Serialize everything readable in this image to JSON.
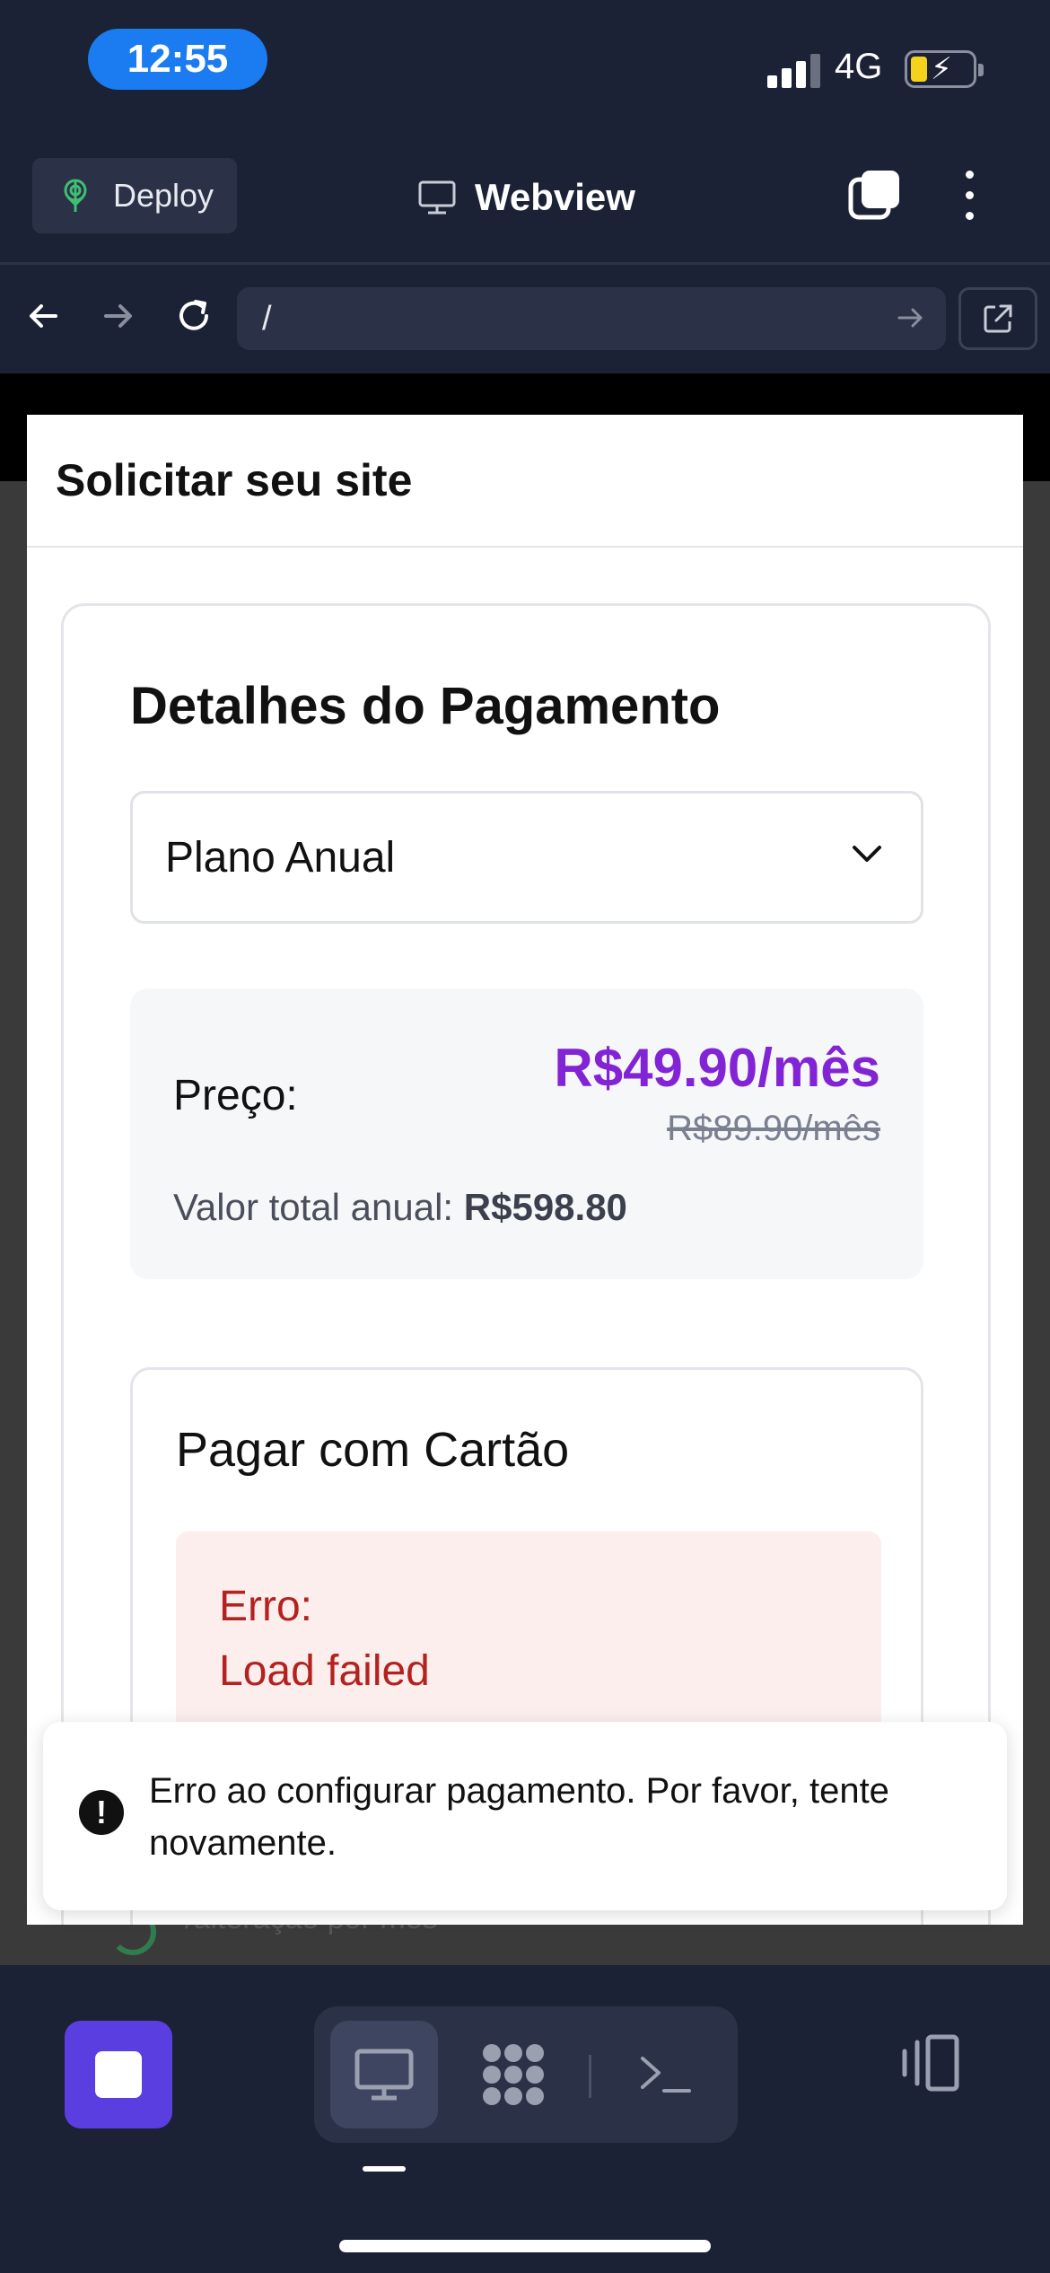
{
  "status_bar": {
    "time": "12:55",
    "network": "4G"
  },
  "header": {
    "deploy_label": "Deploy",
    "title": "Webview"
  },
  "url_bar": {
    "url": "/"
  },
  "modal": {
    "title": "Solicitar seu site",
    "card_title": "Detalhes do Pagamento",
    "plan_select": {
      "selected": "Plano Anual"
    },
    "price": {
      "label": "Preço:",
      "current": "R$49.90/mês",
      "original": "R$89.90/mês",
      "total_label": "Valor total anual: ",
      "total_value": "R$598.80"
    },
    "payment": {
      "title": "Pagar com Cartão",
      "error_heading": "Erro:",
      "error_message": "Load failed"
    }
  },
  "background_page": {
    "partial_text": "/alteração por mês"
  },
  "toast": {
    "message": "Erro ao configurar pagamento. Por favor, tente novamente."
  },
  "colors": {
    "accent": "#8224d6",
    "error": "#b3221e",
    "stop_button": "#5b3ee0",
    "chrome_bg": "#1c2235"
  },
  "icons": [
    "deploy-icon",
    "monitor-icon",
    "tabs-icon",
    "more-icon",
    "back-icon",
    "forward-icon",
    "reload-icon",
    "go-arrow-icon",
    "external-link-icon",
    "chevron-down-icon",
    "alert-icon",
    "stop-icon",
    "monitor-icon",
    "extensions-icon",
    "terminal-icon",
    "split-view-icon"
  ]
}
